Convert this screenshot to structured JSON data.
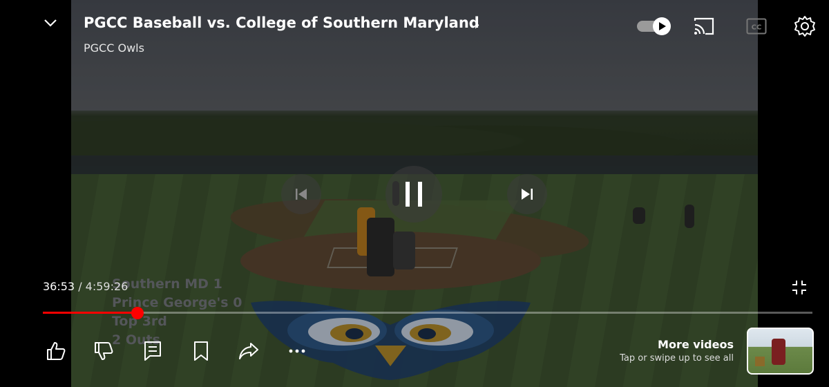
{
  "video": {
    "title": "PGCC Baseball vs. College of Southern Maryland",
    "channel": "PGCC Owls",
    "current_time": "36:53",
    "separator": " / ",
    "duration": "4:59:26",
    "progress": 0.123
  },
  "scoreboard": {
    "line1": "Southern MD 1",
    "line2": "Prince George's 0",
    "line3": "Top 3rd",
    "line4": "2 Outs"
  },
  "more_videos": {
    "title": "More videos",
    "subtitle": "Tap or swipe up to see all"
  },
  "icons": {
    "collapse": "chevron-down-icon",
    "autoplay": "autoplay-toggle-icon",
    "cast": "cast-icon",
    "captions": "captions-icon",
    "settings": "gear-icon",
    "previous": "previous-icon",
    "pause": "pause-icon",
    "next": "next-icon",
    "fullscreen_exit": "exit-fullscreen-icon",
    "like": "thumbs-up-icon",
    "dislike": "thumbs-down-icon",
    "comments": "comments-icon",
    "save": "bookmark-icon",
    "share": "share-icon",
    "more": "more-icon"
  },
  "colors": {
    "progress": "#ff0000",
    "background": "#000000"
  }
}
